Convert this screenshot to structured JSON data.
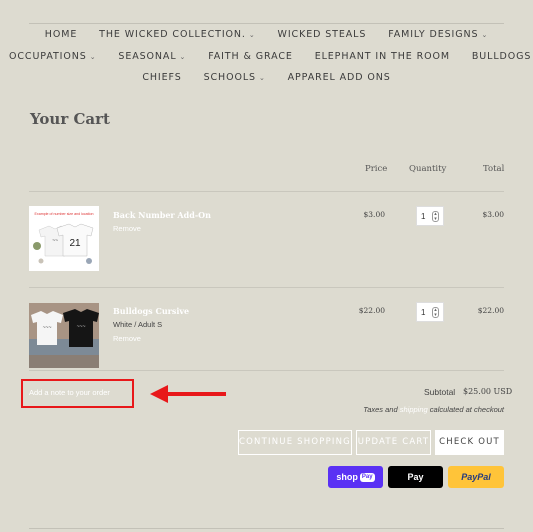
{
  "nav": {
    "row1": [
      {
        "label": "HOME",
        "dropdown": false
      },
      {
        "label": "THE WICKED COLLECTION.",
        "dropdown": true
      },
      {
        "label": "WICKED STEALS",
        "dropdown": false
      },
      {
        "label": "FAMILY DESIGNS",
        "dropdown": true
      }
    ],
    "row2": [
      {
        "label": "OCCUPATIONS",
        "dropdown": true
      },
      {
        "label": "SEASONAL",
        "dropdown": true
      },
      {
        "label": "FAITH & GRACE",
        "dropdown": false
      },
      {
        "label": "ELEPHANT IN THE ROOM",
        "dropdown": false
      },
      {
        "label": "BULLDOGS",
        "dropdown": true
      }
    ],
    "row3": [
      {
        "label": "CHIEFS",
        "dropdown": false
      },
      {
        "label": "SCHOOLS",
        "dropdown": true
      },
      {
        "label": "APPAREL ADD ONS",
        "dropdown": false
      }
    ],
    "chevron": "⌄"
  },
  "cart": {
    "title": "Your Cart",
    "columns": {
      "price": "Price",
      "quantity": "Quantity",
      "total": "Total"
    },
    "items": [
      {
        "name": "Back Number Add-On",
        "variant": "",
        "remove": "Remove",
        "price": "$3.00",
        "qty": "1",
        "total": "$3.00",
        "thumb_caption": "Example of number size and location",
        "thumb_number": "21"
      },
      {
        "name": "Bulldogs Cursive",
        "variant": "White / Adult S",
        "remove": "Remove",
        "price": "$22.00",
        "qty": "1",
        "total": "$22.00"
      }
    ],
    "note_placeholder": "Add a note to your order",
    "subtotal_label": "Subtotal",
    "subtotal_value": "$25.00 USD",
    "taxes_pre": "Taxes and",
    "taxes_link": "shipping",
    "taxes_post": "calculated at checkout",
    "buttons": {
      "continue": "CONTINUE SHOPPING",
      "update": "UPDATE CART",
      "checkout": "CHECK OUT"
    }
  },
  "payments": {
    "shop": "shop",
    "shop_pill": "Pay",
    "apple": " Pay",
    "paypal": "PayPal"
  },
  "colors": {
    "background": "#dddbd0",
    "annotation": "#e8181a",
    "shop_pay": "#5a31f4",
    "paypal": "#ffc439"
  }
}
